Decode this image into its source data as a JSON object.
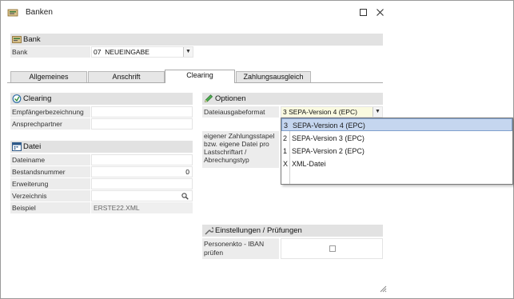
{
  "window": {
    "title": "Banken"
  },
  "bank_section": {
    "title": "Bank",
    "bank_label": "Bank",
    "bank_code": "07",
    "bank_value": "NEUEINGABE"
  },
  "tabs": [
    {
      "label": "Allgemeines"
    },
    {
      "label": "Anschrift"
    },
    {
      "label": "Clearing",
      "active": true
    },
    {
      "label": "Zahlungsausgleich"
    }
  ],
  "clearing": {
    "title": "Clearing",
    "fields": [
      {
        "label": "Empfängerbezeichnung",
        "value": ""
      },
      {
        "label": "Ansprechpartner",
        "value": ""
      }
    ]
  },
  "datei": {
    "title": "Datei",
    "dateiname_label": "Dateiname",
    "dateiname_value": "",
    "bestandsnummer_label": "Bestandsnummer",
    "bestandsnummer_value": "0",
    "erweiterung_label": "Erweiterung",
    "erweiterung_value": "",
    "verzeichnis_label": "Verzeichnis",
    "verzeichnis_value": "",
    "beispiel_label": "Beispiel",
    "beispiel_value": "ERSTE22.XML"
  },
  "optionen": {
    "title": "Optionen",
    "format_label": "Dateiausgabeformat",
    "format_value": "3 SEPA-Version 4 (EPC)",
    "zahlungsstapel_label": "eigener Zahlungsstapel bzw. eigene Datei pro Lastschriftart / Abrechungstyp",
    "options": [
      {
        "code": "3",
        "label": "SEPA-Version 4 (EPC)",
        "selected": true
      },
      {
        "code": "2",
        "label": "SEPA-Version 3 (EPC)"
      },
      {
        "code": "1",
        "label": "SEPA-Version 2 (EPC)"
      },
      {
        "code": "X",
        "label": "XML-Datei"
      }
    ]
  },
  "einstellungen": {
    "title": "Einstellungen / Prüfungen",
    "personenkto_label": "Personenkto - IBAN prüfen",
    "personenkto_checked": false
  },
  "icons": {
    "app": "bank-icon",
    "bank_section": "bank-icon",
    "clearing_section": "clearing-icon",
    "datei_section": "calendar-icon",
    "optionen_section": "pencil-icon",
    "einstellungen_section": "wrench-icon",
    "verzeichnis": "search-icon"
  }
}
